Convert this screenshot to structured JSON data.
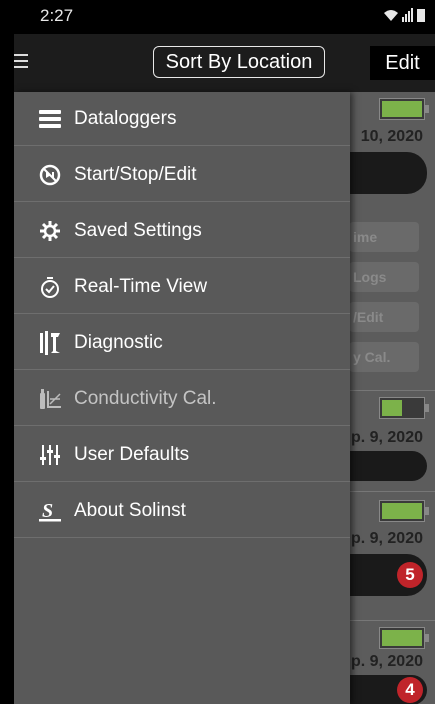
{
  "status_bar": {
    "time": "2:27"
  },
  "app_bar": {
    "sort_button": "Sort By Location",
    "edit_button": "Edit"
  },
  "background": {
    "dates": [
      "10, 2020",
      "p. 9, 2020",
      "p. 9, 2020",
      "p. 9, 2020"
    ],
    "buttons": [
      "ime",
      "Logs",
      "/Edit",
      "y Cal."
    ],
    "badges": [
      "5",
      "4"
    ]
  },
  "menu": {
    "items": [
      {
        "label": "Dataloggers",
        "icon": "list-icon"
      },
      {
        "label": "Start/Stop/Edit",
        "icon": "start-stop-icon"
      },
      {
        "label": "Saved Settings",
        "icon": "gear-icon"
      },
      {
        "label": "Real-Time View",
        "icon": "stopwatch-icon"
      },
      {
        "label": "Diagnostic",
        "icon": "tools-icon"
      },
      {
        "label": "Conductivity Cal.",
        "icon": "conductivity-icon",
        "disabled": true
      },
      {
        "label": "User Defaults",
        "icon": "sliders-icon"
      },
      {
        "label": "About Solinst",
        "icon": "solinst-logo-icon"
      }
    ]
  },
  "colors": {
    "battery_green": "#7cb24a",
    "badge_red": "#c0242a"
  }
}
